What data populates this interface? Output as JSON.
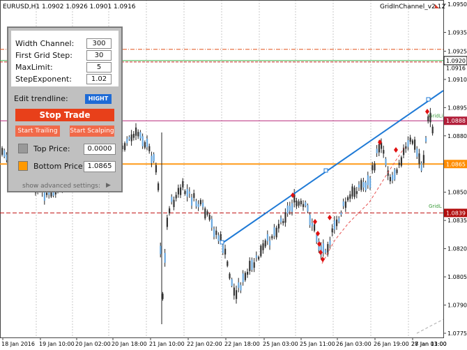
{
  "header": {
    "symbol_info": "EURUSD,H1  1.0902 1.0926 1.0901 1.0916",
    "indicator": "GridInChannel_v2.12"
  },
  "chart_data": {
    "type": "candlestick",
    "symbol": "EURUSD",
    "timeframe": "H1",
    "x_labels": [
      "18 Jan 2016",
      "19 Jan 10:00",
      "20 Jan 02:00",
      "20 Jan 18:00",
      "21 Jan 10:00",
      "22 Jan 02:00",
      "22 Jan 18:00",
      "25 Jan 03:00",
      "25 Jan 11:00",
      "26 Jan 03:00",
      "26 Jan 19:00",
      "27 Jan 11:00",
      "28 Jan 03:00"
    ],
    "y_ticks": [
      "1.0950",
      "1.0935",
      "1.0925",
      "1.0910",
      "1.0895",
      "1.0880",
      "1.0865",
      "1.0850",
      "1.0835",
      "1.0820",
      "1.0805",
      "1.0790",
      "1.0775"
    ],
    "ylim": [
      1.077,
      1.0955
    ],
    "price_tags": [
      {
        "text": "1.0888",
        "value": 1.0888,
        "bg": "#b21f3a"
      },
      {
        "text": "1.0865",
        "value": 1.0865,
        "bg": "#ff8c00"
      },
      {
        "text": "1.0839",
        "value": 1.0839,
        "bg": "#b20e0e"
      }
    ],
    "last_price": {
      "text": "1.0916",
      "value": 1.0916
    },
    "current_price_tag": {
      "text": "1.0920",
      "value": 1.092
    },
    "grid_labels": [
      {
        "text": "GridLi",
        "value": 1.0889
      },
      {
        "text": "GridL",
        "value": 1.0841
      }
    ]
  },
  "panel": {
    "rows": [
      {
        "label": "Width Channel:",
        "value": "300"
      },
      {
        "label": "First Grid Step:",
        "value": "30"
      },
      {
        "label": "MaxLimit:",
        "value": "5"
      },
      {
        "label": "StepExponent:",
        "value": "1.02"
      }
    ],
    "edit_label": "Edit trendline:",
    "hight": "HIGHT",
    "stop": "Stop Trade",
    "start_trailing": "Start Trailing",
    "start_scalping": "Start Scalping",
    "top_price_label": "Top Price:",
    "top_price_value": "0.0000",
    "bottom_price_label": "Bottom Price:",
    "bottom_price_value": "1.0865",
    "advanced": "show advanced settings:",
    "colors": {
      "top_box": "#999999",
      "bottom_box": "#ff9900"
    }
  }
}
